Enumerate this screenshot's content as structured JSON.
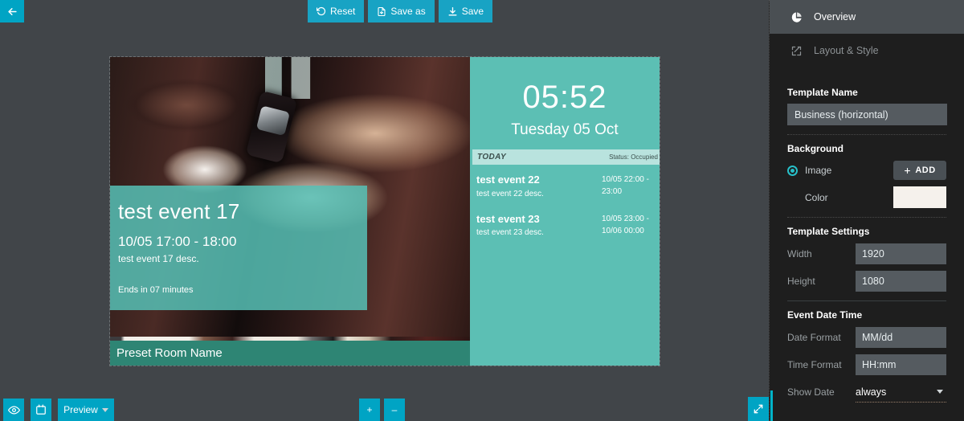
{
  "topbar": {
    "back_icon": "arrow-left-icon",
    "actions": [
      {
        "label": "Reset",
        "icon": "refresh-icon"
      },
      {
        "label": "Save as",
        "icon": "file-save-icon"
      },
      {
        "label": "Save",
        "icon": "download-icon"
      }
    ]
  },
  "preview": {
    "event_card": {
      "title": "test event 17",
      "time": "10/05 17:00 - 18:00",
      "desc": "test event 17 desc.",
      "ends": "Ends in 07 minutes"
    },
    "room_name": "Preset Room Name",
    "clock": {
      "time": "05:52",
      "date": "Tuesday 05 Oct"
    },
    "today_bar": {
      "label": "TODAY",
      "status": "Status: Occupied"
    },
    "events": [
      {
        "name": "test event 22",
        "desc": "test event 22 desc.",
        "time": "10/05 22:00 - 23:00"
      },
      {
        "name": "test event 23",
        "desc": "test event 23 desc.",
        "time": "10/05 23:00 - 10/06 00:00"
      }
    ]
  },
  "bottombar": {
    "eye_icon": "eye-icon",
    "calendar_icon": "calendar-icon",
    "preview_label": "Preview",
    "zoom_in": "+",
    "zoom_out": "–",
    "expand_icon": "expand-arrows-icon"
  },
  "sidebar": {
    "tabs": [
      {
        "label": "Overview",
        "icon": "pie-chart-icon",
        "active": true
      },
      {
        "label": "Layout & Style",
        "icon": "edit-pencil-icon",
        "active": false
      }
    ],
    "template_name": {
      "heading": "Template Name",
      "value": "Business (horizontal)"
    },
    "background": {
      "heading": "Background",
      "image_label": "Image",
      "image_selected": true,
      "add_label": "ADD",
      "add_icon": "plus-icon",
      "color_label": "Color",
      "color_value": "#f5f1ec"
    },
    "template_settings": {
      "heading": "Template Settings",
      "width_label": "Width",
      "width_value": "1920",
      "height_label": "Height",
      "height_value": "1080"
    },
    "event_date_time": {
      "heading": "Event Date Time",
      "date_format_label": "Date Format",
      "date_format_value": "MM/dd",
      "time_format_label": "Time Format",
      "time_format_value": "HH:mm",
      "show_date_label": "Show Date",
      "show_date_value": "always"
    }
  },
  "colors": {
    "accent_cyan": "#00a4c4",
    "teal": "#5cbfb4",
    "teal_dark": "#2e8574",
    "teal_light": "#b9e3de",
    "sidebar_bg": "#1e1e1e",
    "canvas_bg": "#414549"
  }
}
